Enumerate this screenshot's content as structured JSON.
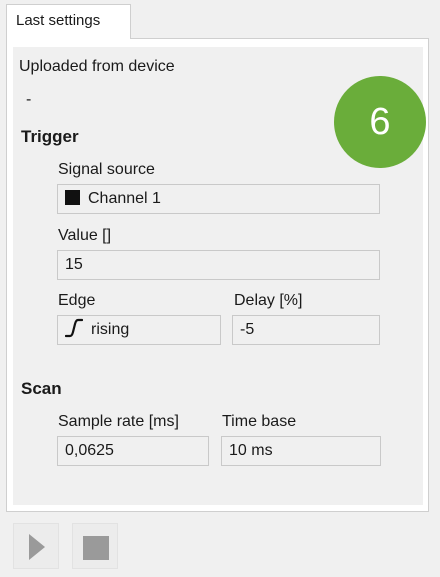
{
  "tab": {
    "label": "Last settings"
  },
  "upload": {
    "label": "Uploaded from device",
    "value": "-"
  },
  "trigger": {
    "title": "Trigger",
    "signal_source": {
      "label": "Signal source",
      "value": "Channel 1",
      "swatch_color": "#111111"
    },
    "value": {
      "label": "Value []",
      "value": "15"
    },
    "edge": {
      "label": "Edge",
      "value": "rising",
      "icon": "rising-edge-icon"
    },
    "delay": {
      "label": "Delay [%]",
      "value": "-5"
    }
  },
  "scan": {
    "title": "Scan",
    "sample_rate": {
      "label": "Sample rate [ms]",
      "value": "0,0625"
    },
    "time_base": {
      "label": "Time base",
      "value": "10 ms"
    }
  },
  "badge": {
    "number": "6",
    "color": "#6aad3a"
  },
  "toolbar": {
    "play_icon": "play-icon",
    "stop_icon": "stop-icon",
    "icon_color": "#9a9a9a"
  }
}
